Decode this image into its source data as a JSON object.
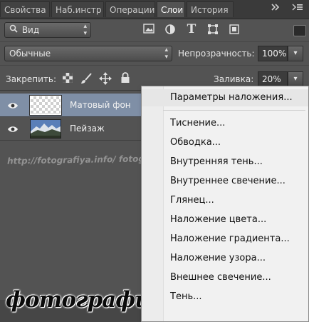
{
  "tabs": [
    {
      "label": "Свойства",
      "active": false
    },
    {
      "label": "Наб.инстр",
      "active": false
    },
    {
      "label": "Операции",
      "active": false
    },
    {
      "label": "Слои",
      "active": true
    },
    {
      "label": "История",
      "active": false
    }
  ],
  "tab_bar": {
    "overflow_icon": "double-chevron-right-icon",
    "menu_icon": "panel-menu-icon"
  },
  "filter_row": {
    "filter_type_label": "Вид",
    "filter_icons": [
      "image-filter-icon",
      "adjustment-filter-icon",
      "type-filter-icon",
      "shape-filter-icon",
      "smart-object-filter-icon"
    ]
  },
  "blend_row": {
    "blend_mode": "Обычные",
    "opacity_label": "Непрозрачность:",
    "opacity_value": "100%"
  },
  "lock_row": {
    "lock_label": "Закрепить:",
    "lock_icons": [
      "lock-transparency-icon",
      "lock-brush-icon",
      "lock-position-icon",
      "lock-all-icon"
    ],
    "fill_label": "Заливка:",
    "fill_value": "20%"
  },
  "layers": [
    {
      "name": "Матовый фон",
      "selected": true,
      "thumb": "transparent-thumbnail"
    },
    {
      "name": "Пейзаж",
      "selected": false,
      "thumb": "landscape-thumbnail"
    }
  ],
  "watermark": "http://fotografiya.info/   fotografiya.info",
  "logo_text": "фотография",
  "context_menu": {
    "items": [
      {
        "label": "Параметры наложения...",
        "highlighted": true
      },
      {
        "label": "Тиснение...",
        "highlighted": false
      },
      {
        "label": "Обводка...",
        "highlighted": false
      },
      {
        "label": "Внутренняя тень...",
        "highlighted": false
      },
      {
        "label": "Внутреннее свечение...",
        "highlighted": false
      },
      {
        "label": "Глянец...",
        "highlighted": false
      },
      {
        "label": "Наложение цвета...",
        "highlighted": false
      },
      {
        "label": "Наложение градиента...",
        "highlighted": false
      },
      {
        "label": "Наложение узора...",
        "highlighted": false
      },
      {
        "label": "Внешнее свечение...",
        "highlighted": false
      },
      {
        "label": "Тень...",
        "highlighted": false
      }
    ]
  },
  "colors": {
    "panel_bg": "#535353",
    "selected_layer": "#7f8fa6",
    "menu_bg": "#f1f1f1",
    "tab_bar": "#3a3a3a"
  }
}
